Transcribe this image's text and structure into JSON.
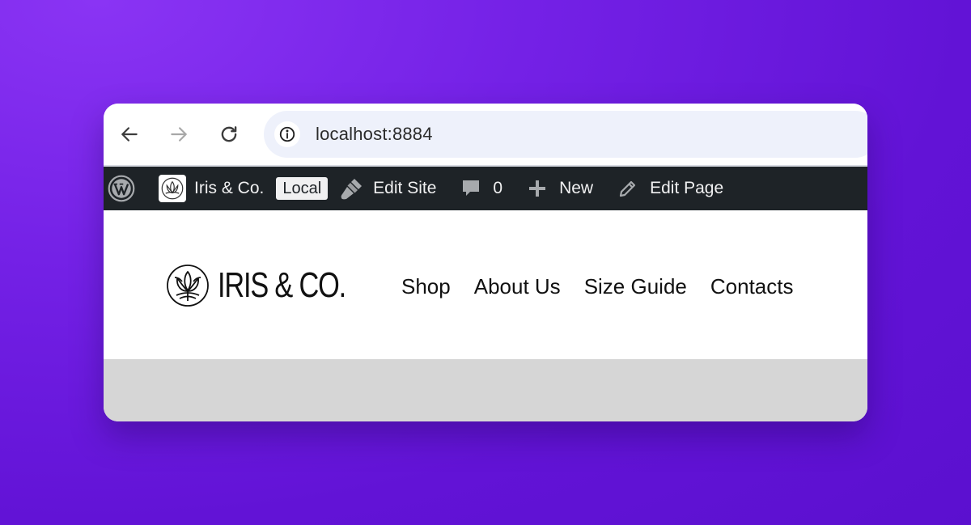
{
  "browser": {
    "url": "localhost:8884",
    "back_icon": "arrow-left-icon",
    "forward_icon": "arrow-right-icon",
    "reload_icon": "reload-icon",
    "site_info_icon": "info-icon"
  },
  "admin_bar": {
    "wp_logo_icon": "wordpress-logo-icon",
    "site_name": "Iris & Co.",
    "env_badge": "Local",
    "edit_site": "Edit Site",
    "comments_count": "0",
    "new": "New",
    "edit_page": "Edit Page",
    "background_color": "#1e2327"
  },
  "site": {
    "logo_text": "IRIS & CO.",
    "nav": [
      "Shop",
      "About Us",
      "Size Guide",
      "Contacts"
    ]
  },
  "colors": {
    "page_background": "#6a19dc",
    "omnibox": "#eef1fb",
    "hero_placeholder": "#d6d6d6"
  }
}
